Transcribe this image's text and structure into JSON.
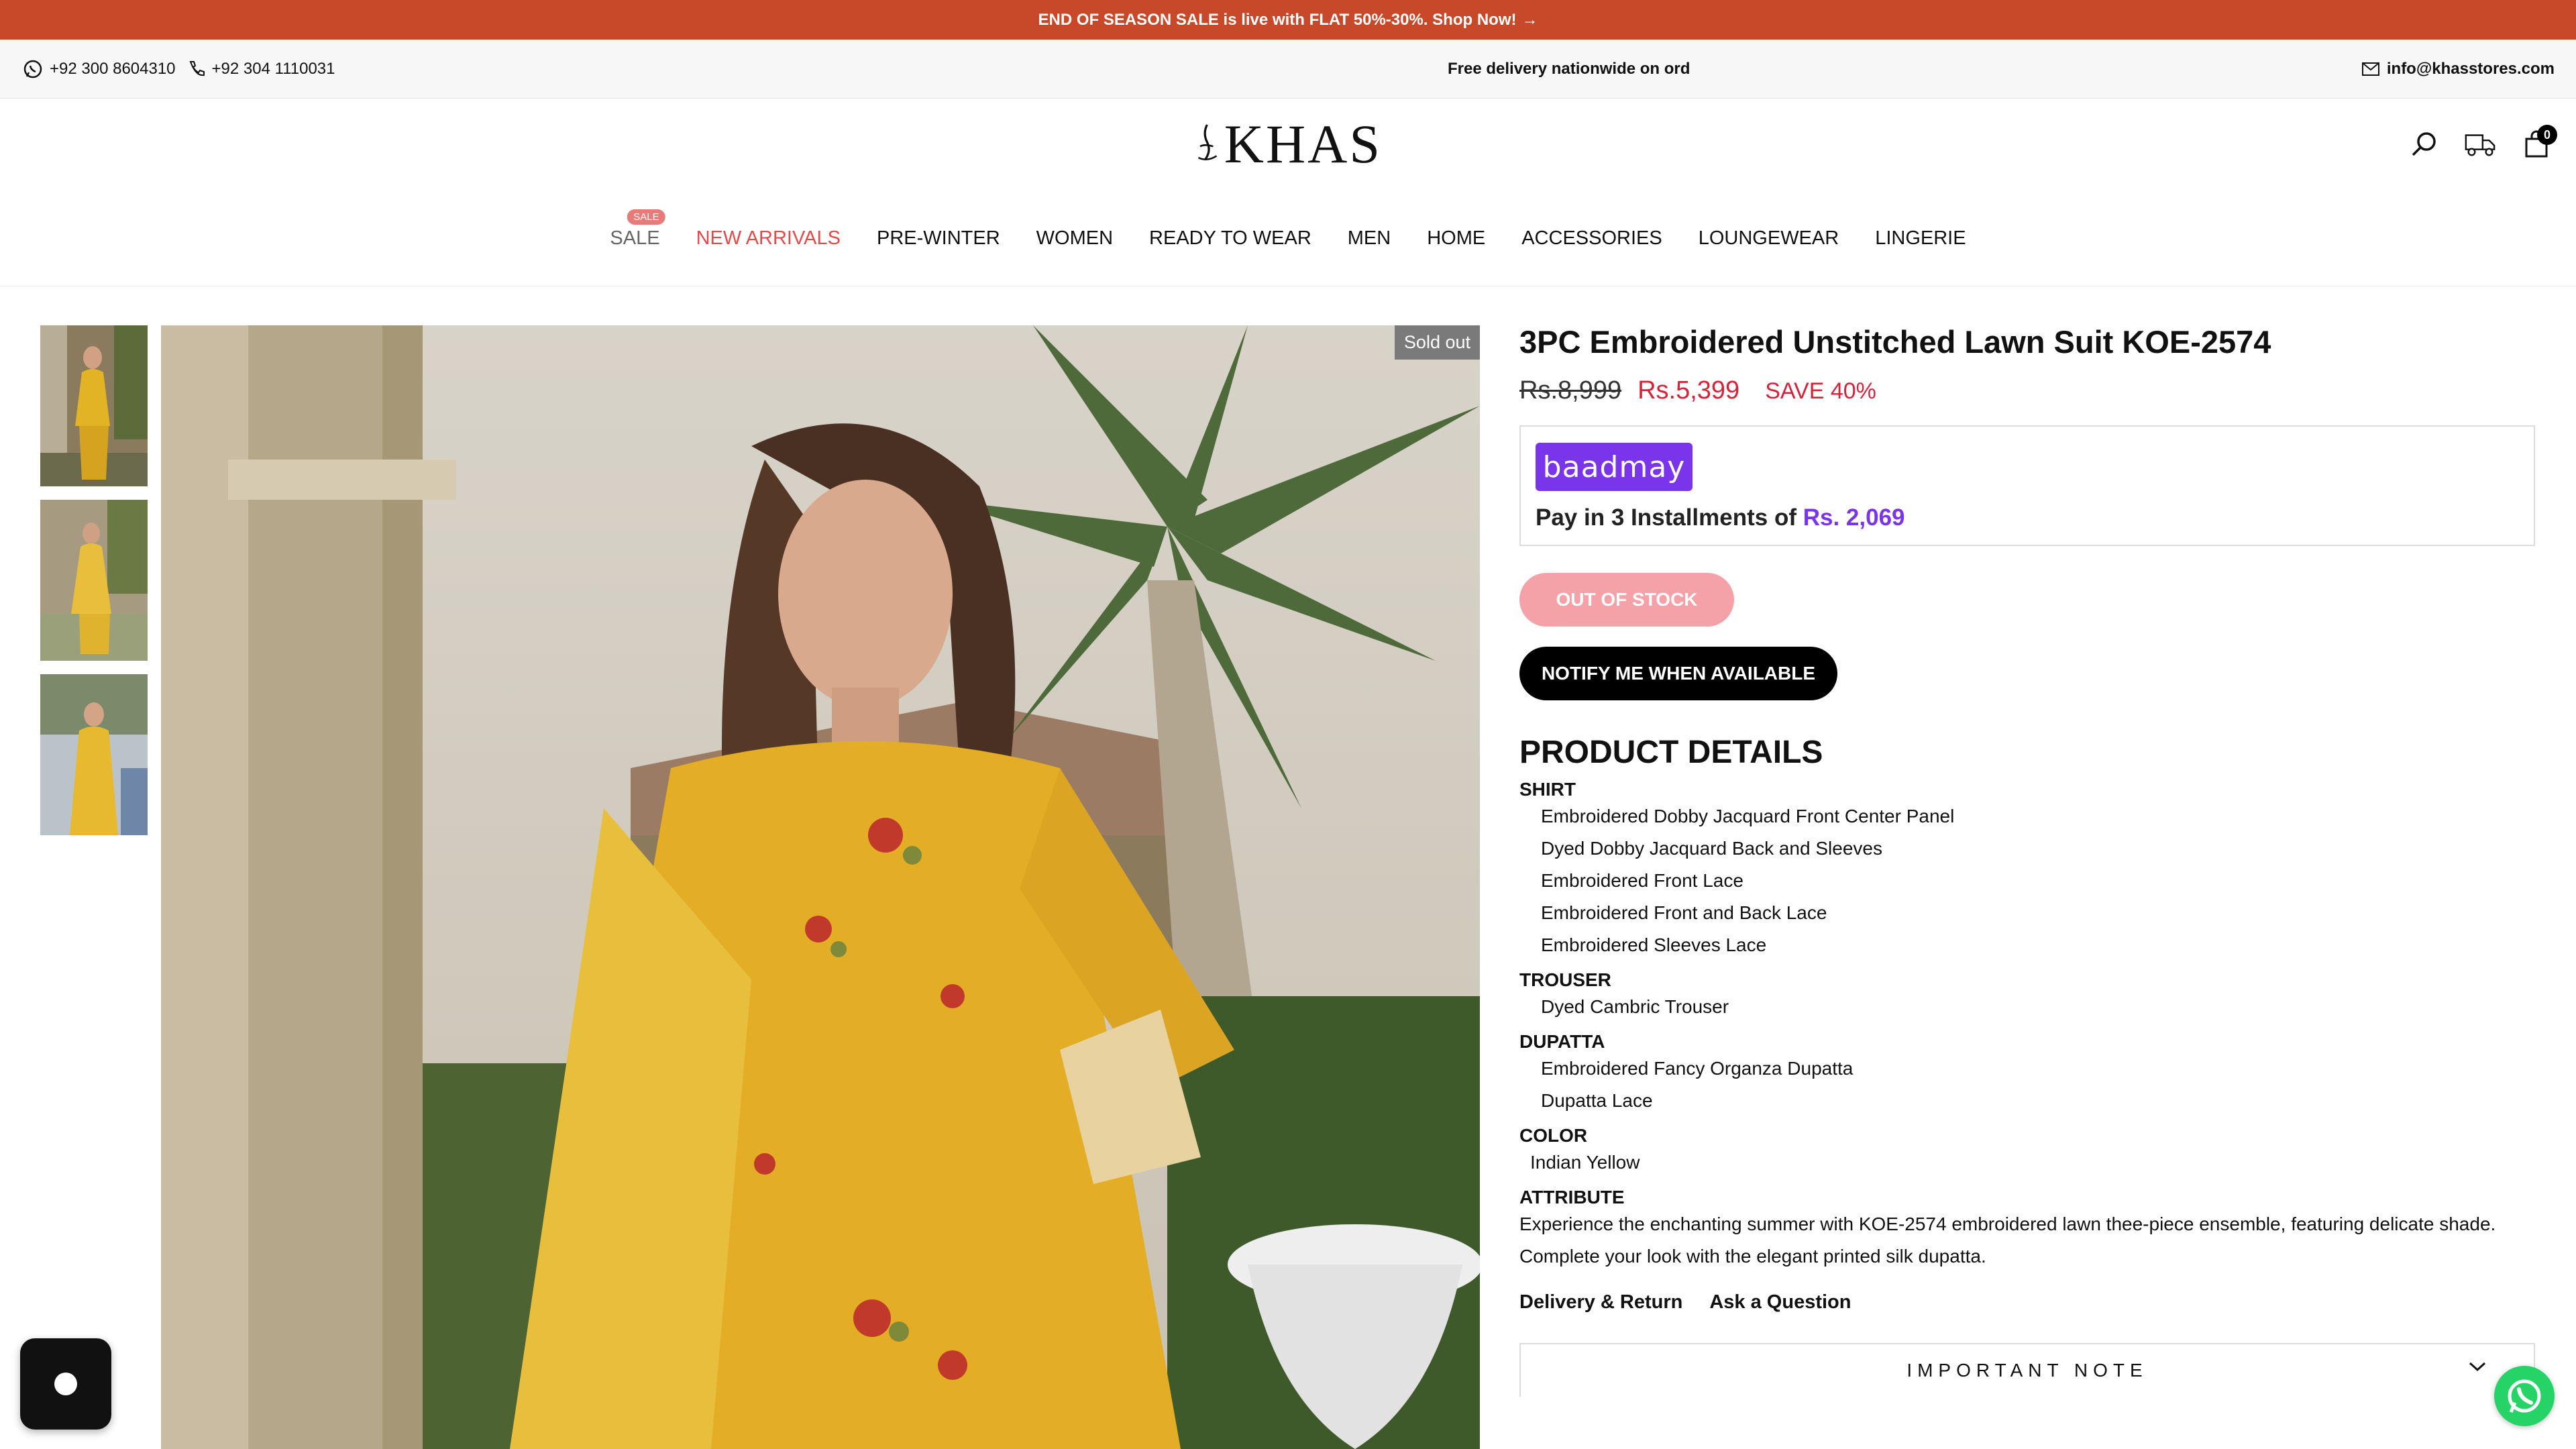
{
  "announcement": {
    "text": "END OF SEASON SALE is live with FLAT 50%-30%. Shop Now!",
    "arrow": "→",
    "color": "#c8492a"
  },
  "contact": {
    "phone1": "+92 300 8604310",
    "phone2": "+92 304 1110031",
    "marquee": "Free delivery nationwide on ord",
    "email": "info@khasstores.com",
    "icons": [
      "whatsapp-icon",
      "phone-icon",
      "mail-icon"
    ]
  },
  "header": {
    "logo_text": "KHAS",
    "cart_count": "0",
    "icons": [
      "search-icon",
      "delivery-truck-icon",
      "cart-bag-icon"
    ]
  },
  "nav": {
    "items": [
      {
        "label": "SALE",
        "badge": "SALE"
      },
      {
        "label": "NEW ARRIVALS"
      },
      {
        "label": "PRE-WINTER"
      },
      {
        "label": "WOMEN"
      },
      {
        "label": "READY TO WEAR"
      },
      {
        "label": "MEN"
      },
      {
        "label": "HOME"
      },
      {
        "label": "ACCESSORIES"
      },
      {
        "label": "LOUNGEWEAR"
      },
      {
        "label": "LINGERIE"
      }
    ]
  },
  "gallery": {
    "sold_out": "Sold out",
    "thumb_count": 3
  },
  "product": {
    "title": "3PC Embroidered Unstitched Lawn Suit KOE-2574",
    "price_old": "Rs.8,999",
    "price_new": "Rs.5,399",
    "save": "SAVE 40%",
    "baadmay_logo": "baadmay",
    "installment_text": "Pay in 3 Installments of ",
    "installment_amount": "Rs. 2,069",
    "out_of_stock": "OUT OF STOCK",
    "notify": "NOTIFY ME WHEN AVAILABLE",
    "details_heading": "PRODUCT DETAILS",
    "shirt_title": "SHIRT",
    "shirt_items": [
      "Embroidered Dobby Jacquard Front Center Panel",
      "Dyed Dobby Jacquard Back and Sleeves",
      "Embroidered Front Lace",
      "Embroidered Front and Back Lace",
      "Embroidered Sleeves Lace"
    ],
    "trouser_title": "TROUSER",
    "trouser_items": [
      "Dyed Cambric Trouser"
    ],
    "dupatta_title": "DUPATTA",
    "dupatta_items": [
      "Embroidered Fancy Organza Dupatta",
      "Dupatta Lace"
    ],
    "color_title": "COLOR",
    "color_value": "Indian Yellow",
    "attribute_title": "ATTRIBUTE",
    "attribute_line1": "Experience the enchanting summer with KOE-2574 embroidered lawn thee-piece ensemble, featuring delicate shade.",
    "attribute_line2": "Complete your look with the elegant printed silk dupatta.",
    "tab_delivery": "Delivery & Return",
    "tab_question": "Ask a Question",
    "important_note": "IMPORTANT NOTE"
  },
  "colors": {
    "accent_purple": "#7a35ea",
    "sale_red": "#d4243a",
    "whatsapp_green": "#25d366"
  }
}
